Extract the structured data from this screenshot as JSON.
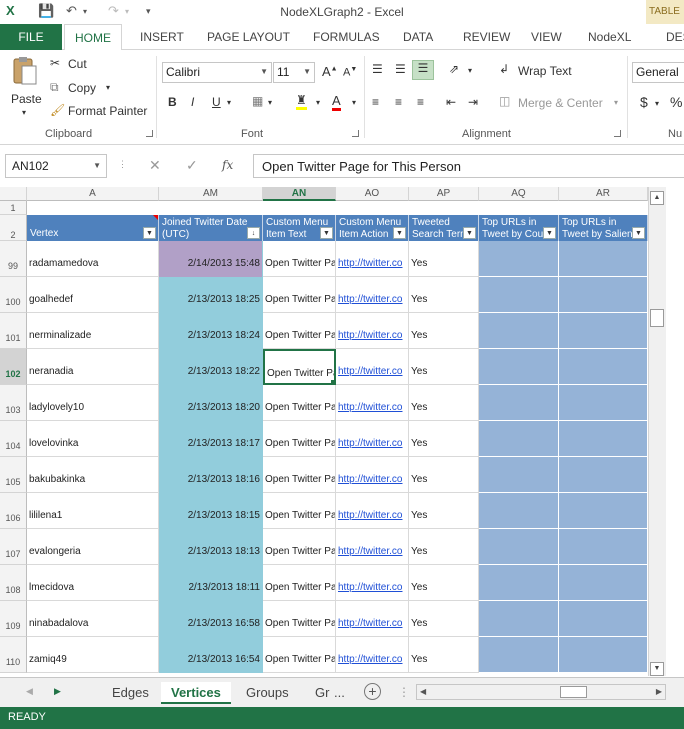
{
  "window": {
    "title": "NodeXLGraph2 - Excel",
    "table_tools_label": "TABLE"
  },
  "ribbon_tabs": [
    "FILE",
    "HOME",
    "INSERT",
    "PAGE LAYOUT",
    "FORMULAS",
    "DATA",
    "REVIEW",
    "VIEW",
    "NodeXL",
    "DES"
  ],
  "clipboard": {
    "paste": "Paste",
    "cut": "Cut",
    "copy": "Copy",
    "format_painter": "Format Painter",
    "group_label": "Clipboard"
  },
  "font": {
    "name": "Calibri",
    "size": "11",
    "bold": "B",
    "italic": "I",
    "underline": "U",
    "group_label": "Font"
  },
  "alignment": {
    "wrap_text": "Wrap Text",
    "merge_center": "Merge & Center",
    "group_label": "Alignment"
  },
  "number": {
    "format": "General",
    "currency": "$",
    "percent": "%",
    "group_label": "Nu"
  },
  "formula_bar": {
    "name_box": "AN102",
    "fx": "fx",
    "content": "Open Twitter Page for This Person"
  },
  "columns": [
    {
      "letter": "A",
      "header": "Vertex"
    },
    {
      "letter": "AM",
      "header": "Joined Twitter Date (UTC)"
    },
    {
      "letter": "AN",
      "header": "Custom Menu Item Text"
    },
    {
      "letter": "AO",
      "header": "Custom Menu Item Action"
    },
    {
      "letter": "AP",
      "header": "Tweeted Search Term?"
    },
    {
      "letter": "AQ",
      "header": "Top URLs in Tweet by Count"
    },
    {
      "letter": "AR",
      "header": "Top URLs in Tweet by Salience"
    }
  ],
  "header_rows": [
    "1",
    "2"
  ],
  "rows": [
    {
      "num": "99",
      "vertex": "radamamedova",
      "joined": "2/14/2013 15:48",
      "menu_text": "Open Twitter Pa",
      "menu_action": "http://twitter.co",
      "tweeted": "Yes"
    },
    {
      "num": "100",
      "vertex": "goalhedef",
      "joined": "2/13/2013 18:25",
      "menu_text": "Open Twitter Pa",
      "menu_action": "http://twitter.co",
      "tweeted": "Yes"
    },
    {
      "num": "101",
      "vertex": "nerminalizade",
      "joined": "2/13/2013 18:24",
      "menu_text": "Open Twitter Pa",
      "menu_action": "http://twitter.co",
      "tweeted": "Yes"
    },
    {
      "num": "102",
      "vertex": "neranadia",
      "joined": "2/13/2013 18:22",
      "menu_text": "Open Twitter Pa",
      "menu_action": "http://twitter.co",
      "tweeted": "Yes"
    },
    {
      "num": "103",
      "vertex": "ladylovely10",
      "joined": "2/13/2013 18:20",
      "menu_text": "Open Twitter Pa",
      "menu_action": "http://twitter.co",
      "tweeted": "Yes"
    },
    {
      "num": "104",
      "vertex": "lovelovinka",
      "joined": "2/13/2013 18:17",
      "menu_text": "Open Twitter Pa",
      "menu_action": "http://twitter.co",
      "tweeted": "Yes"
    },
    {
      "num": "105",
      "vertex": "bakubakinka",
      "joined": "2/13/2013 18:16",
      "menu_text": "Open Twitter Pa",
      "menu_action": "http://twitter.co",
      "tweeted": "Yes"
    },
    {
      "num": "106",
      "vertex": "lililena1",
      "joined": "2/13/2013 18:15",
      "menu_text": "Open Twitter Pa",
      "menu_action": "http://twitter.co",
      "tweeted": "Yes"
    },
    {
      "num": "107",
      "vertex": "evalongeria",
      "joined": "2/13/2013 18:13",
      "menu_text": "Open Twitter Pa",
      "menu_action": "http://twitter.co",
      "tweeted": "Yes"
    },
    {
      "num": "108",
      "vertex": "lmecidova",
      "joined": "2/13/2013 18:11",
      "menu_text": "Open Twitter Pa",
      "menu_action": "http://twitter.co",
      "tweeted": "Yes"
    },
    {
      "num": "109",
      "vertex": "ninabadalova",
      "joined": "2/13/2013 16:58",
      "menu_text": "Open Twitter Pa",
      "menu_action": "http://twitter.co",
      "tweeted": "Yes"
    },
    {
      "num": "110",
      "vertex": "zamiq49",
      "joined": "2/13/2013 16:54",
      "menu_text": "Open Twitter Pa",
      "menu_action": "http://twitter.co",
      "tweeted": "Yes"
    }
  ],
  "sheet_tabs": [
    "Edges",
    "Vertices",
    "Groups",
    "Gr",
    "..."
  ],
  "status": "READY",
  "colors": {
    "excel_green": "#217346",
    "header_blue": "#4f81bd",
    "date_cyan": "#92cddc",
    "date_first_purple": "#b1a0c7",
    "url_blue": "#95b3d7"
  }
}
